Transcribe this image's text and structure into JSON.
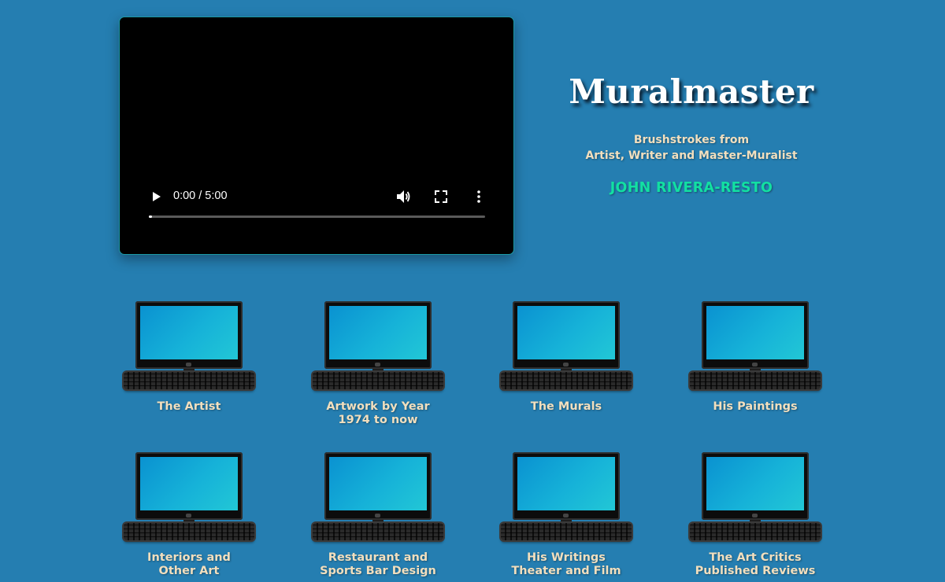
{
  "video": {
    "time_display": "0:00 / 5:00",
    "progress": 0.01,
    "play_icon": "play-icon",
    "volume_icon": "volume-icon",
    "fullscreen_icon": "fullscreen-icon",
    "menu_icon": "more-vert-icon"
  },
  "header": {
    "site_title": "Muralmaster",
    "tagline_line1": "Brushstrokes from",
    "tagline_line2": "Artist, Writer and Master-Muralist",
    "artist_name": "JOHN RIVERA-RESTO"
  },
  "colors": {
    "background": "#257eb1",
    "label_text": "#f2dfbe",
    "artist_name": "#12e0a2",
    "screen_gradient": [
      "#0a92d1",
      "#22c7d6"
    ]
  },
  "tiles": [
    {
      "icon": "computer-icon",
      "line1": "The Artist",
      "line2": ""
    },
    {
      "icon": "computer-icon",
      "line1": "Artwork by Year",
      "line2": "1974 to now"
    },
    {
      "icon": "computer-icon",
      "line1": "The Murals",
      "line2": ""
    },
    {
      "icon": "computer-icon",
      "line1": "His Paintings",
      "line2": ""
    },
    {
      "icon": "computer-icon",
      "line1": "Interiors and",
      "line2": "Other Art"
    },
    {
      "icon": "computer-icon",
      "line1": "Restaurant and",
      "line2": "Sports Bar Design"
    },
    {
      "icon": "computer-icon",
      "line1": "His Writings",
      "line2": "Theater and Film"
    },
    {
      "icon": "computer-icon",
      "line1": "The Art Critics",
      "line2": "Published Reviews"
    }
  ]
}
